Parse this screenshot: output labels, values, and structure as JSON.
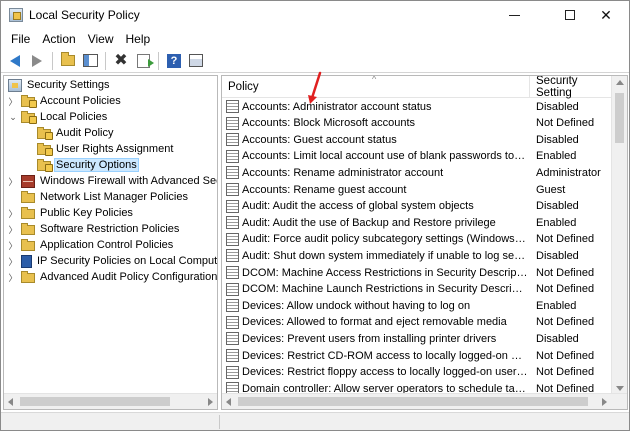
{
  "window": {
    "title": "Local Security Policy",
    "icon": "security-policy-icon",
    "controls": {
      "minimize": "minimize-icon",
      "maximize": "maximize-icon",
      "close": "✕"
    }
  },
  "menu": [
    "File",
    "Action",
    "View",
    "Help"
  ],
  "toolbar": [
    "back-arrow-icon",
    "forward-arrow-icon",
    "up-folder-icon",
    "show-hide-tree-icon",
    "delete-icon",
    "export-list-icon",
    "help-icon",
    "properties-icon"
  ],
  "tree": {
    "root": "Security Settings",
    "items": [
      {
        "label": "Account Policies",
        "expanded": false
      },
      {
        "label": "Local Policies",
        "expanded": true
      },
      {
        "label": "Audit Policy"
      },
      {
        "label": "User Rights Assignment"
      },
      {
        "label": "Security Options",
        "selected": true
      },
      {
        "label": "Windows Firewall with Advanced Secu"
      },
      {
        "label": "Network List Manager Policies"
      },
      {
        "label": "Public Key Policies"
      },
      {
        "label": "Software Restriction Policies"
      },
      {
        "label": "Application Control Policies"
      },
      {
        "label": "IP Security Policies on Local Compute"
      },
      {
        "label": "Advanced Audit Policy Configuration"
      }
    ]
  },
  "list": {
    "columns": [
      "Policy",
      "Security Setting"
    ],
    "sort_indicator": "^",
    "rows": [
      {
        "policy": "Accounts: Administrator account status",
        "setting": "Disabled"
      },
      {
        "policy": "Accounts: Block Microsoft accounts",
        "setting": "Not Defined"
      },
      {
        "policy": "Accounts: Guest account status",
        "setting": "Disabled"
      },
      {
        "policy": "Accounts: Limit local account use of blank passwords to co...",
        "setting": "Enabled"
      },
      {
        "policy": "Accounts: Rename administrator account",
        "setting": "Administrator"
      },
      {
        "policy": "Accounts: Rename guest account",
        "setting": "Guest"
      },
      {
        "policy": "Audit: Audit the access of global system objects",
        "setting": "Disabled"
      },
      {
        "policy": "Audit: Audit the use of Backup and Restore privilege",
        "setting": "Enabled"
      },
      {
        "policy": "Audit: Force audit policy subcategory settings (Windows Vis...",
        "setting": "Not Defined"
      },
      {
        "policy": "Audit: Shut down system immediately if unable to log secur...",
        "setting": "Disabled"
      },
      {
        "policy": "DCOM: Machine Access Restrictions in Security Descriptor D...",
        "setting": "Not Defined"
      },
      {
        "policy": "DCOM: Machine Launch Restrictions in Security Descriptor ...",
        "setting": "Not Defined"
      },
      {
        "policy": "Devices: Allow undock without having to log on",
        "setting": "Enabled"
      },
      {
        "policy": "Devices: Allowed to format and eject removable media",
        "setting": "Not Defined"
      },
      {
        "policy": "Devices: Prevent users from installing printer drivers",
        "setting": "Disabled"
      },
      {
        "policy": "Devices: Restrict CD-ROM access to locally logged-on user ...",
        "setting": "Not Defined"
      },
      {
        "policy": "Devices: Restrict floppy access to locally logged-on user only",
        "setting": "Not Defined"
      },
      {
        "policy": "Domain controller: Allow server operators to schedule tasks",
        "setting": "Not Defined"
      }
    ]
  },
  "colors": {
    "annotation_arrow": "#e02020",
    "selection_bg": "#cce8ff"
  }
}
